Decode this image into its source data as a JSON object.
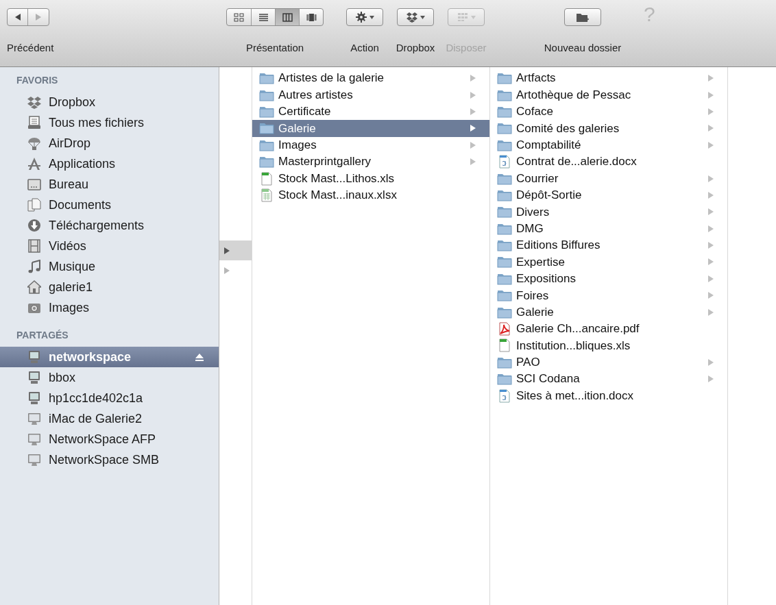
{
  "toolbar": {
    "nav": {
      "label": "Précédent",
      "back_enabled": true,
      "forward_enabled": false
    },
    "view": {
      "label": "Présentation",
      "modes": [
        {
          "kind": "icons",
          "selected": false
        },
        {
          "kind": "list",
          "selected": false
        },
        {
          "kind": "columns",
          "selected": true
        },
        {
          "kind": "coverflow",
          "selected": false
        }
      ]
    },
    "buttons": [
      {
        "kind": "action",
        "label": "Action",
        "disabled": false
      },
      {
        "kind": "dropbox",
        "label": "Dropbox",
        "disabled": false
      },
      {
        "kind": "arrange",
        "label": "Disposer",
        "disabled": true
      }
    ],
    "new_folder": {
      "label": "Nouveau dossier"
    },
    "help": "?"
  },
  "sidebar": {
    "sections": [
      {
        "title": "FAVORIS",
        "items": [
          {
            "kind": "dropbox",
            "label": "Dropbox",
            "selected": false,
            "eject": false
          },
          {
            "kind": "all-files",
            "label": "Tous mes fichiers",
            "selected": false,
            "eject": false
          },
          {
            "kind": "airdrop",
            "label": "AirDrop",
            "selected": false,
            "eject": false
          },
          {
            "kind": "applications",
            "label": "Applications",
            "selected": false,
            "eject": false
          },
          {
            "kind": "desktop",
            "label": "Bureau",
            "selected": false,
            "eject": false
          },
          {
            "kind": "documents",
            "label": "Documents",
            "selected": false,
            "eject": false
          },
          {
            "kind": "downloads",
            "label": "Téléchargements",
            "selected": false,
            "eject": false
          },
          {
            "kind": "movies",
            "label": "Vidéos",
            "selected": false,
            "eject": false
          },
          {
            "kind": "music",
            "label": "Musique",
            "selected": false,
            "eject": false
          },
          {
            "kind": "home",
            "label": "galerie1",
            "selected": false,
            "eject": false
          },
          {
            "kind": "pictures",
            "label": "Images",
            "selected": false,
            "eject": false
          }
        ]
      },
      {
        "title": "PARTAGÉS",
        "items": [
          {
            "kind": "server",
            "label": "networkspace",
            "selected": true,
            "eject": true
          },
          {
            "kind": "server",
            "label": "bbox",
            "selected": false,
            "eject": false
          },
          {
            "kind": "server",
            "label": "hp1cc1de402c1a",
            "selected": false,
            "eject": false
          },
          {
            "kind": "computer",
            "label": "iMac de Galerie2",
            "selected": false,
            "eject": false
          },
          {
            "kind": "computer",
            "label": "NetworkSpace AFP",
            "selected": false,
            "eject": false
          },
          {
            "kind": "computer",
            "label": "NetworkSpace SMB",
            "selected": false,
            "eject": false
          }
        ]
      }
    ]
  },
  "previous_column": {
    "items": [
      {
        "selected": true
      },
      {
        "selected": false
      }
    ]
  },
  "columns": [
    {
      "items": [
        {
          "kind": "folder",
          "label": "Artistes de la galerie",
          "selected": false
        },
        {
          "kind": "folder",
          "label": "Autres artistes",
          "selected": false
        },
        {
          "kind": "folder",
          "label": "Certificate",
          "selected": false
        },
        {
          "kind": "folder",
          "label": "Galerie",
          "selected": true
        },
        {
          "kind": "folder",
          "label": "Images",
          "selected": false
        },
        {
          "kind": "folder",
          "label": "Masterprintgallery",
          "selected": false
        },
        {
          "kind": "xls",
          "label": "Stock Mast...Lithos.xls",
          "selected": false
        },
        {
          "kind": "xlsx",
          "label": "Stock Mast...inaux.xlsx",
          "selected": false
        }
      ]
    },
    {
      "items": [
        {
          "kind": "folder",
          "label": "Artfacts",
          "selected": false
        },
        {
          "kind": "folder",
          "label": "Artothèque de Pessac",
          "selected": false
        },
        {
          "kind": "folder",
          "label": "Coface",
          "selected": false
        },
        {
          "kind": "folder",
          "label": "Comité des galeries",
          "selected": false
        },
        {
          "kind": "folder",
          "label": "Comptabilité",
          "selected": false
        },
        {
          "kind": "docx",
          "label": "Contrat de...alerie.docx",
          "selected": false
        },
        {
          "kind": "folder",
          "label": "Courrier",
          "selected": false
        },
        {
          "kind": "folder",
          "label": "Dépôt-Sortie",
          "selected": false
        },
        {
          "kind": "folder",
          "label": "Divers",
          "selected": false
        },
        {
          "kind": "folder",
          "label": "DMG",
          "selected": false
        },
        {
          "kind": "folder",
          "label": "Editions Biffures",
          "selected": false
        },
        {
          "kind": "folder",
          "label": "Expertise",
          "selected": false
        },
        {
          "kind": "folder",
          "label": "Expositions",
          "selected": false
        },
        {
          "kind": "folder",
          "label": "Foires",
          "selected": false
        },
        {
          "kind": "folder",
          "label": "Galerie",
          "selected": false
        },
        {
          "kind": "pdf",
          "label": "Galerie Ch...ancaire.pdf",
          "selected": false
        },
        {
          "kind": "xls",
          "label": "Institution...bliques.xls",
          "selected": false
        },
        {
          "kind": "folder",
          "label": "PAO",
          "selected": false
        },
        {
          "kind": "folder",
          "label": "SCI Codana",
          "selected": false
        },
        {
          "kind": "docx",
          "label": "Sites à met...ition.docx",
          "selected": false
        }
      ]
    }
  ]
}
